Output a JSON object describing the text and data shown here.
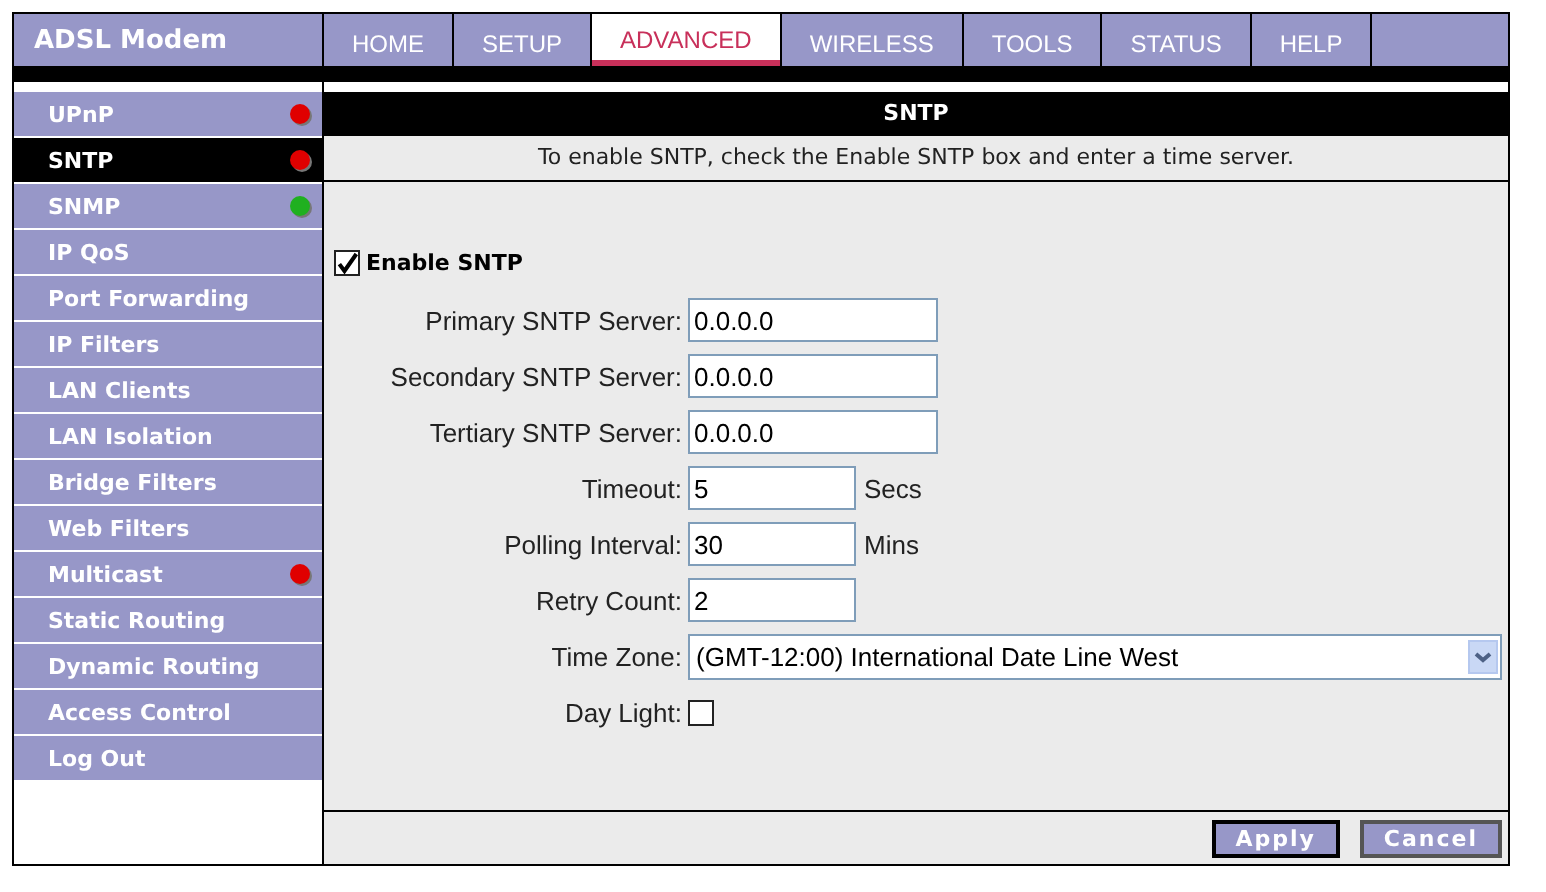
{
  "brand": "ADSL Modem",
  "nav": [
    {
      "label": "HOME",
      "selected": false
    },
    {
      "label": "SETUP",
      "selected": false
    },
    {
      "label": "ADVANCED",
      "selected": true
    },
    {
      "label": "WIRELESS",
      "selected": false
    },
    {
      "label": "TOOLS",
      "selected": false
    },
    {
      "label": "STATUS",
      "selected": false
    },
    {
      "label": "HELP",
      "selected": false
    }
  ],
  "sidebar": {
    "items": [
      {
        "label": "UPnP",
        "selected": false,
        "color": "#e00000"
      },
      {
        "label": "SNTP",
        "selected": true,
        "color": "#e00000"
      },
      {
        "label": "SNMP",
        "selected": false,
        "color": "#20b020"
      },
      {
        "label": "IP QoS",
        "selected": false
      },
      {
        "label": "Port Forwarding",
        "selected": false
      },
      {
        "label": "IP Filters",
        "selected": false
      },
      {
        "label": "LAN Clients",
        "selected": false
      },
      {
        "label": "LAN Isolation",
        "selected": false
      },
      {
        "label": "Bridge Filters",
        "selected": false
      },
      {
        "label": "Web Filters",
        "selected": false
      },
      {
        "label": "Multicast",
        "selected": false,
        "color": "#e00000"
      },
      {
        "label": "Static Routing",
        "selected": false
      },
      {
        "label": "Dynamic Routing",
        "selected": false
      },
      {
        "label": "Access Control",
        "selected": false
      },
      {
        "label": "Log Out",
        "selected": false
      }
    ]
  },
  "panel": {
    "title": "SNTP",
    "description": "To enable SNTP, check the Enable SNTP box and enter a time server.",
    "enable": {
      "label": "Enable SNTP",
      "checked": true
    },
    "fields": [
      {
        "kind": "text",
        "label": "Primary SNTP Server:",
        "value": "0.0.0.0"
      },
      {
        "kind": "text",
        "label": "Secondary SNTP Server:",
        "value": "0.0.0.0"
      },
      {
        "kind": "text",
        "label": "Tertiary SNTP Server:",
        "value": "0.0.0.0"
      },
      {
        "kind": "short",
        "label": "Timeout:",
        "value": "5",
        "unit": "Secs"
      },
      {
        "kind": "short",
        "label": "Polling Interval:",
        "value": "30",
        "unit": "Mins"
      },
      {
        "kind": "short",
        "label": "Retry Count:",
        "value": "2"
      },
      {
        "kind": "select",
        "label": "Time Zone:",
        "value": "(GMT-12:00) International Date Line West"
      },
      {
        "kind": "checkbox",
        "label": "Day Light:",
        "checked": false
      }
    ],
    "buttons": [
      "Apply",
      "Cancel"
    ]
  }
}
